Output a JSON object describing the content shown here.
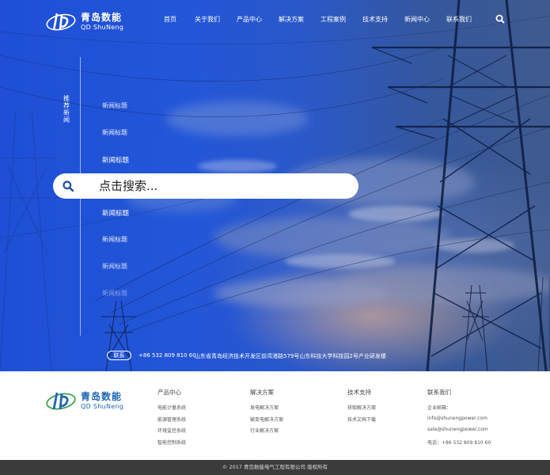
{
  "brand": {
    "name_cn": "青岛数能",
    "name_en": "QD ShuNeng",
    "colors": {
      "blue": "#1f66b5",
      "green": "#3aa64a",
      "hero_blue": "#1e4fd6"
    }
  },
  "nav": {
    "items": [
      "首页",
      "关于我们",
      "产品中心",
      "解决方案",
      "工程案例",
      "技术支持",
      "新闻中心",
      "联系我们"
    ],
    "search_icon": "search-icon"
  },
  "sidebar": {
    "label": "推荐新闻",
    "news": [
      "新闻标题",
      "新闻标题",
      "新闻标题",
      "新闻标题",
      "新闻标题",
      "新闻标题",
      "新闻标题"
    ]
  },
  "search": {
    "placeholder": "点击搜索..."
  },
  "contact": {
    "badge": "联系",
    "phone": "+86 532 809 810 60",
    "address": "山东省青岛经济技术开发区前湾港路579号山东科技大学科技园2号产业研发楼"
  },
  "footer": {
    "columns": [
      {
        "title": "产品中心",
        "items": [
          "电能计量系统",
          "能源管理系统",
          "环境监控系统",
          "智能控制系统"
        ]
      },
      {
        "title": "解决方案",
        "items": [
          "发电解决方案",
          "输变电解决方案",
          "行业解决方案"
        ]
      },
      {
        "title": "技术支持",
        "items": [
          "获取解决方案",
          "技术文档下载"
        ]
      },
      {
        "title": "联系我们",
        "items": [
          "企业邮箱：",
          "info@shunengpower.com",
          "sale@shunengpower.com",
          "电话：+86 532 809 810 60"
        ]
      }
    ],
    "copyright": "© 2017 青岛数能电气工程有限公司 版权所有"
  }
}
